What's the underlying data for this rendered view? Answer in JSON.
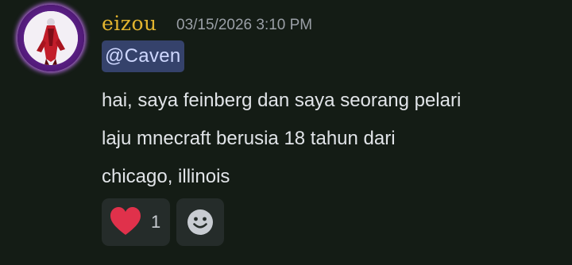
{
  "message": {
    "author": {
      "username": "eizou",
      "username_color": "#e3b52f",
      "avatar_icon": "avatar-icon"
    },
    "timestamp": "03/15/2026 3:10 PM",
    "mention": "@Caven",
    "content_lines": [
      "hai, saya feinberg dan saya seorang pelari",
      "laju mnecraft berusia 18 tahun dari",
      "chicago, illinois"
    ],
    "reactions": [
      {
        "emoji": "heart-icon",
        "count": "1",
        "color": "#e0314b"
      }
    ],
    "add_reaction_icon": "smiley-icon"
  },
  "colors": {
    "background": "#141c15",
    "mention_bg": "#35426b",
    "reaction_bg": "#252c2a"
  }
}
